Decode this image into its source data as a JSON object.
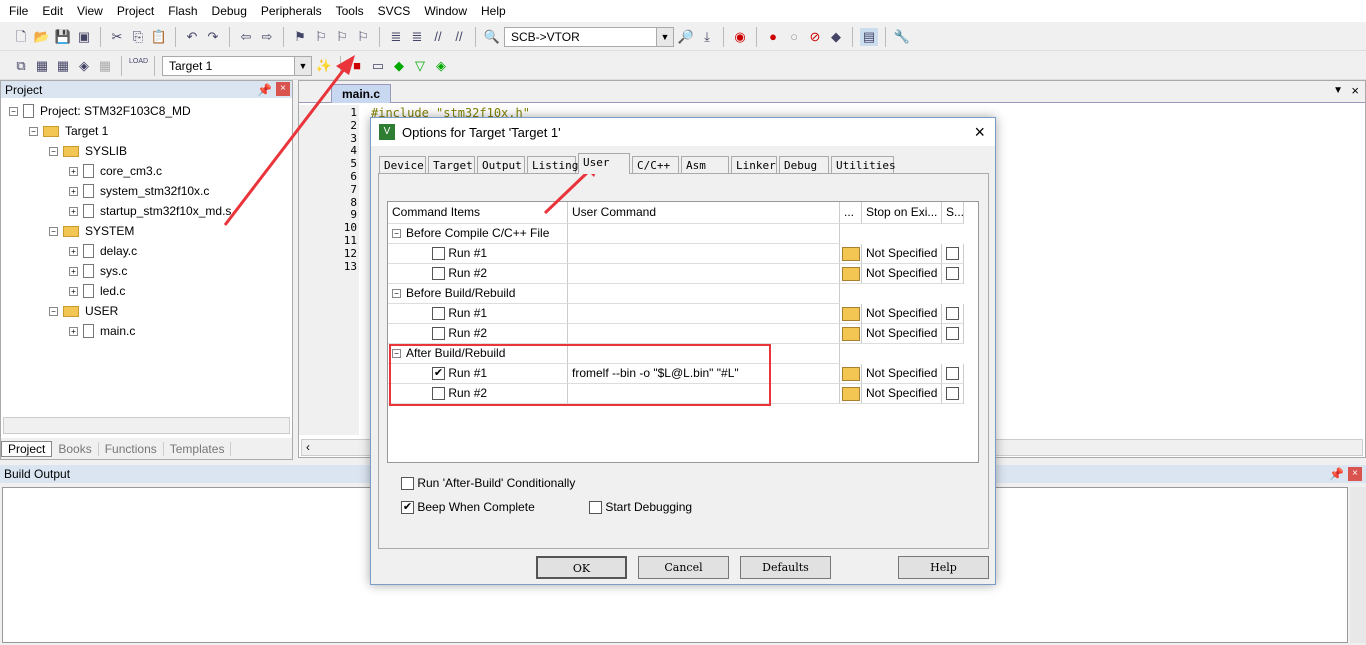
{
  "menu": [
    "File",
    "Edit",
    "View",
    "Project",
    "Flash",
    "Debug",
    "Peripherals",
    "Tools",
    "SVCS",
    "Window",
    "Help"
  ],
  "toolbar": {
    "find_combo": "SCB->VTOR",
    "target_combo": "Target 1",
    "load_label": "LOAD"
  },
  "project_panel": {
    "title": "Project",
    "root": "Project: STM32F103C8_MD",
    "target": "Target 1",
    "groups": [
      {
        "name": "SYSLIB",
        "files": [
          "core_cm3.c",
          "system_stm32f10x.c",
          "startup_stm32f10x_md.s"
        ]
      },
      {
        "name": "SYSTEM",
        "files": [
          "delay.c",
          "sys.c",
          "led.c"
        ]
      },
      {
        "name": "USER",
        "files": [
          "main.c"
        ]
      }
    ],
    "tabs": [
      "Project",
      "Books",
      "Functions",
      "Templates"
    ]
  },
  "editor": {
    "tab": "main.c",
    "first_line": "#include \"stm32f10x.h\"",
    "line_numbers": [
      "1",
      "2",
      "3",
      "4",
      "5",
      "6",
      "7",
      "8",
      "9",
      "10",
      "11",
      "12",
      "13"
    ]
  },
  "build_output": {
    "title": "Build Output"
  },
  "dialog": {
    "title": "Options for Target 'Target 1'",
    "tabs": [
      "Device",
      "Target",
      "Output",
      "Listing",
      "User",
      "C/C++",
      "Asm",
      "Linker",
      "Debug",
      "Utilities"
    ],
    "active_tab": "User",
    "columns": [
      "Command Items",
      "User Command",
      "...",
      "Stop on Exi...",
      "S..."
    ],
    "groups": [
      {
        "name": "Before Compile C/C++ File",
        "runs": [
          {
            "label": "Run #1",
            "checked": false,
            "command": "",
            "stop": "Not Specified"
          },
          {
            "label": "Run #2",
            "checked": false,
            "command": "",
            "stop": "Not Specified"
          }
        ]
      },
      {
        "name": "Before Build/Rebuild",
        "runs": [
          {
            "label": "Run #1",
            "checked": false,
            "command": "",
            "stop": "Not Specified"
          },
          {
            "label": "Run #2",
            "checked": false,
            "command": "",
            "stop": "Not Specified"
          }
        ]
      },
      {
        "name": "After Build/Rebuild",
        "runs": [
          {
            "label": "Run #1",
            "checked": true,
            "command": "fromelf --bin -o \"$L@L.bin\" \"#L\"",
            "stop": "Not Specified"
          },
          {
            "label": "Run #2",
            "checked": false,
            "command": "",
            "stop": "Not Specified"
          }
        ]
      }
    ],
    "options": {
      "run_after_build_conditionally": {
        "label": "Run 'After-Build' Conditionally",
        "checked": false
      },
      "beep_when_complete": {
        "label": "Beep When Complete",
        "checked": true
      },
      "start_debugging": {
        "label": "Start Debugging",
        "checked": false
      }
    },
    "buttons": {
      "ok": "OK",
      "cancel": "Cancel",
      "defaults": "Defaults",
      "help": "Help"
    }
  },
  "colors": {
    "annotation_red": "#e8343a",
    "panel_header": "#dbe5f1"
  }
}
